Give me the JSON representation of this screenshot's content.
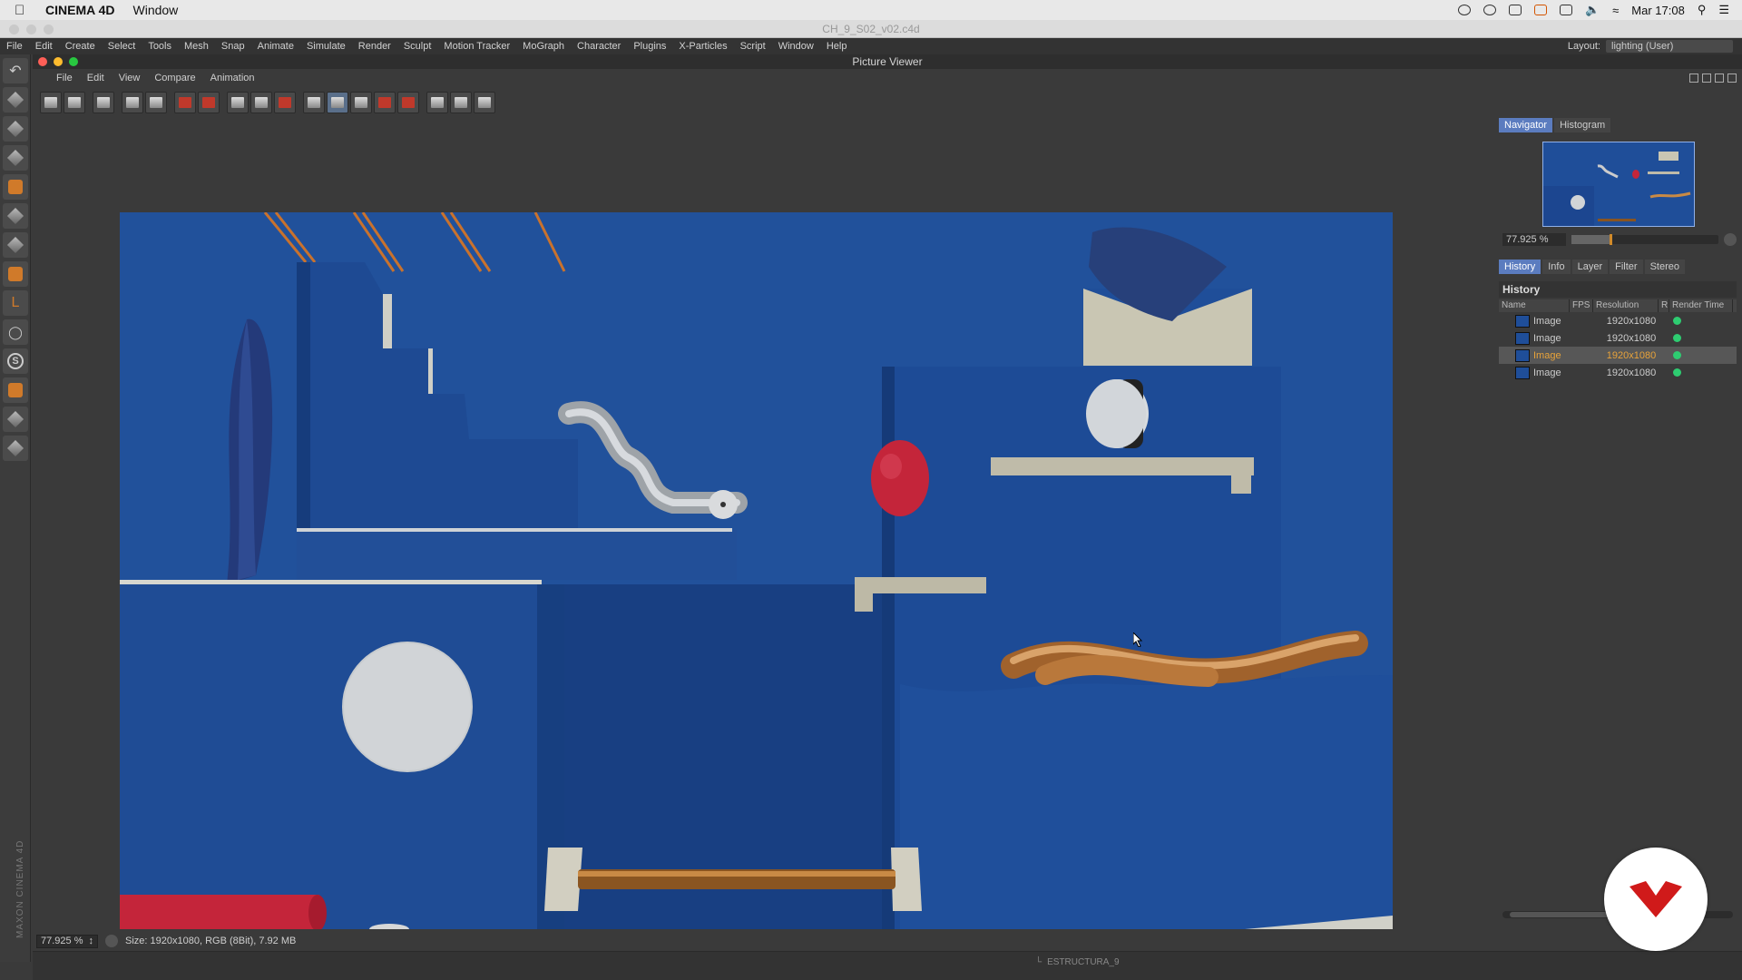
{
  "mac_menubar": {
    "app_name": "CINEMA 4D",
    "menu_window": "Window",
    "clock": "Mar 17:08"
  },
  "document": {
    "title": "CH_9_S02_v02.c4d"
  },
  "c4d_menu": {
    "items": [
      "File",
      "Edit",
      "Create",
      "Select",
      "Tools",
      "Mesh",
      "Snap",
      "Animate",
      "Simulate",
      "Render",
      "Sculpt",
      "Motion Tracker",
      "MoGraph",
      "Character",
      "Plugins",
      "X-Particles",
      "Script",
      "Window",
      "Help"
    ],
    "layout_label": "Layout:",
    "layout_value": "lighting (User)"
  },
  "picture_viewer": {
    "title": "Picture Viewer",
    "menu": [
      "File",
      "Edit",
      "View",
      "Compare",
      "Animation"
    ],
    "status_zoom": "77.925 %",
    "status_text": "Size: 1920x1080, RGB (8Bit), 7.92 MB"
  },
  "navigator": {
    "tabs": [
      "Navigator",
      "Histogram"
    ],
    "zoom": "77.925 %",
    "zoom_level": 0.26
  },
  "history": {
    "tabs": [
      "History",
      "Info",
      "Layer",
      "Filter",
      "Stereo"
    ],
    "title": "History",
    "columns": [
      "Name",
      "FPS",
      "Resolution",
      "R",
      "Render Time"
    ],
    "rows": [
      {
        "name": "Image",
        "resolution": "1920x1080",
        "selected": false
      },
      {
        "name": "Image",
        "resolution": "1920x1080",
        "selected": false
      },
      {
        "name": "Image",
        "resolution": "1920x1080",
        "selected": true
      },
      {
        "name": "Image",
        "resolution": "1920x1080",
        "selected": false
      }
    ]
  },
  "bottom_strip": {
    "object_name": "ESTRUCTURA_9"
  },
  "branding": {
    "maxon": "MAXON CINEMA 4D"
  },
  "colors": {
    "scene_blue": "#1f4e99",
    "accent_tab": "#5b7cbf",
    "selected_orange": "#e8a33a",
    "status_green": "#2ecc71",
    "badge_red": "#d01a1a"
  }
}
